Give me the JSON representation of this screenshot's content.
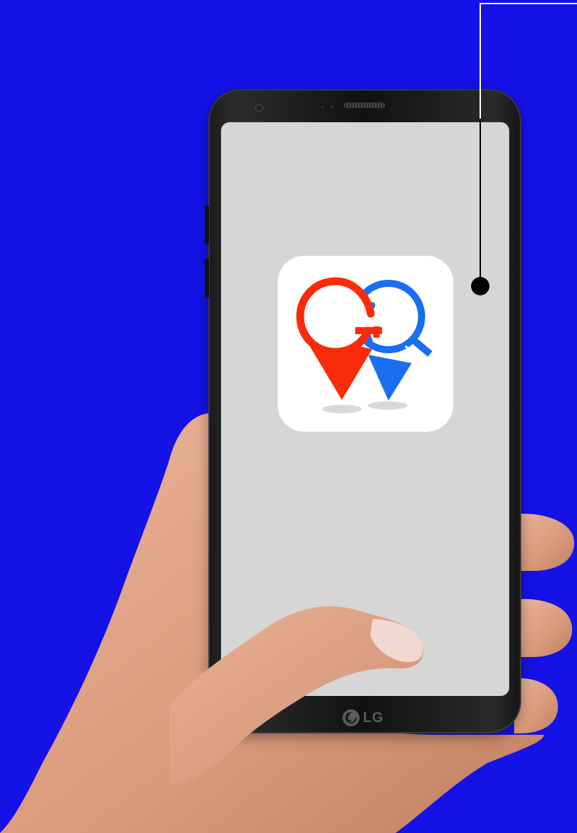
{
  "background_color": "#1412e6",
  "device": {
    "brand_label": "LG",
    "screen_color": "#d6d6d6"
  },
  "app": {
    "icon_letters": [
      "G",
      "Q"
    ],
    "colors": {
      "red": "#fa2b0a",
      "blue": "#1a6ef2"
    }
  }
}
